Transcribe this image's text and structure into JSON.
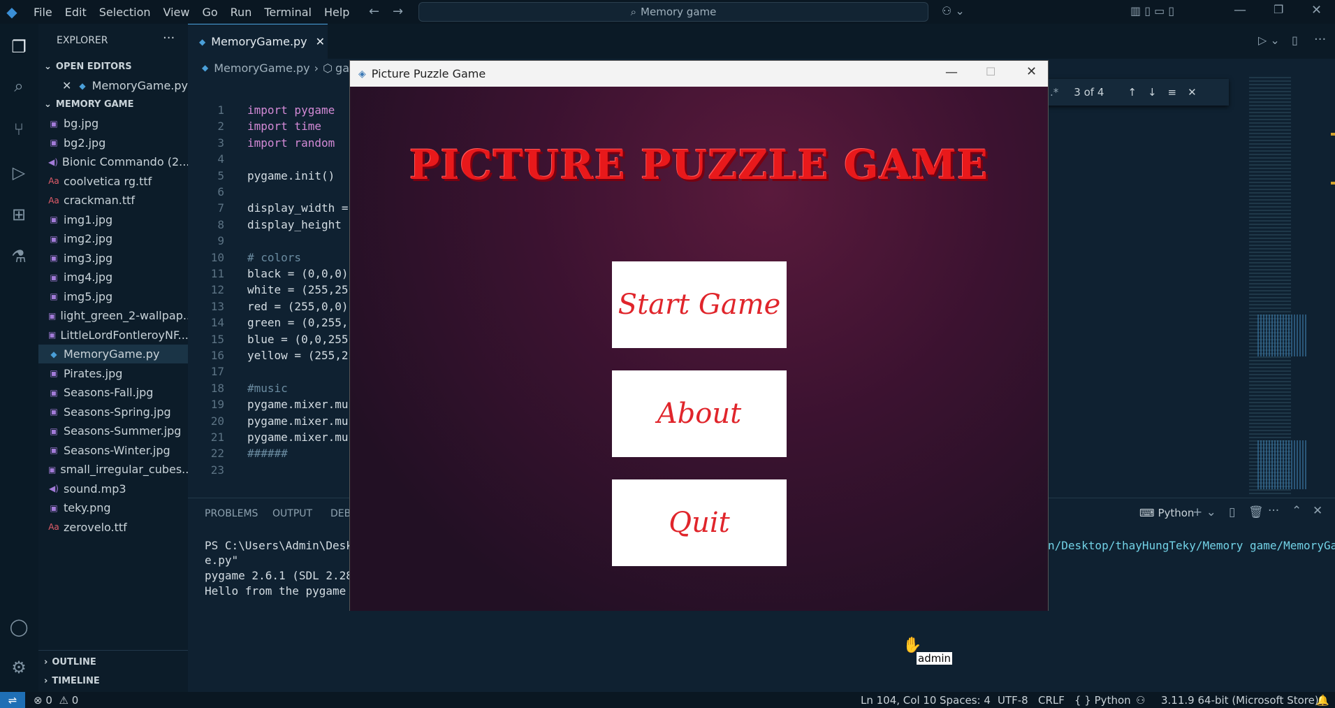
{
  "menu": [
    "File",
    "Edit",
    "Selection",
    "View",
    "Go",
    "Run",
    "Terminal",
    "Help"
  ],
  "search": {
    "text": "Memory game"
  },
  "sidebar": {
    "title": "EXPLORER",
    "open_editors": "OPEN EDITORS",
    "open_file": "MemoryGame.py",
    "folder": "MEMORY GAME",
    "files": [
      "bg.jpg",
      "bg2.jpg",
      "Bionic Commando (2...",
      "coolvetica rg.ttf",
      "crackman.ttf",
      "img1.jpg",
      "img2.jpg",
      "img3.jpg",
      "img4.jpg",
      "img5.jpg",
      "light_green_2-wallpap...",
      "LittleLordFontleroyNF...",
      "MemoryGame.py",
      "Pirates.jpg",
      "Seasons-Fall.jpg",
      "Seasons-Spring.jpg",
      "Seasons-Summer.jpg",
      "Seasons-Winter.jpg",
      "small_irregular_cubes...",
      "sound.mp3",
      "teky.png",
      "zerovelo.ttf"
    ],
    "outline": "OUTLINE",
    "timeline": "TIMELINE"
  },
  "editor": {
    "tab": "MemoryGame.py",
    "breadcrumb_file": "MemoryGame.py",
    "breadcrumb_sym": "ga",
    "lines": [
      {
        "n": "1",
        "t": "import pygame"
      },
      {
        "n": "2",
        "t": "import time"
      },
      {
        "n": "3",
        "t": "import random"
      },
      {
        "n": "4",
        "t": ""
      },
      {
        "n": "5",
        "t": "pygame.init()"
      },
      {
        "n": "6",
        "t": ""
      },
      {
        "n": "7",
        "t": "display_width ="
      },
      {
        "n": "8",
        "t": "display_height"
      },
      {
        "n": "9",
        "t": ""
      },
      {
        "n": "10",
        "t": "# colors"
      },
      {
        "n": "11",
        "t": "black = (0,0,0)"
      },
      {
        "n": "12",
        "t": "white = (255,25"
      },
      {
        "n": "13",
        "t": "red = (255,0,0)"
      },
      {
        "n": "14",
        "t": "green = (0,255,"
      },
      {
        "n": "15",
        "t": "blue = (0,0,255"
      },
      {
        "n": "16",
        "t": "yellow = (255,2"
      },
      {
        "n": "17",
        "t": ""
      },
      {
        "n": "18",
        "t": "#music"
      },
      {
        "n": "19",
        "t": "pygame.mixer.mu"
      },
      {
        "n": "20",
        "t": "pygame.mixer.mu"
      },
      {
        "n": "21",
        "t": "pygame.mixer.mu"
      },
      {
        "n": "22",
        "t": "######"
      },
      {
        "n": "23",
        "t": ""
      }
    ],
    "find_count": "3 of 4"
  },
  "panel": {
    "tabs": [
      "PROBLEMS",
      "OUTPUT",
      "DEBU"
    ],
    "terminal_name": "Python",
    "lines": [
      "PS C:\\Users\\Admin\\Deskt",
      "e.py\"",
      "pygame 2.6.1 (SDL 2.28.",
      "Hello from the pygame c"
    ],
    "path_right": "n/Desktop/thayHungTeky/Memory game/MemoryGam"
  },
  "game": {
    "window_title": "Picture Puzzle Game",
    "heading": "PICTURE PUZZLE GAME",
    "buttons": [
      "Start Game",
      "About",
      "Quit"
    ]
  },
  "cursor_label": "admin",
  "status": {
    "errors": "0",
    "warnings": "0",
    "position": "Ln 104, Col 10",
    "spaces": "Spaces: 4",
    "encoding": "UTF-8",
    "eol": "CRLF",
    "language": "Python",
    "interpreter": "3.11.9 64-bit (Microsoft Store)"
  }
}
